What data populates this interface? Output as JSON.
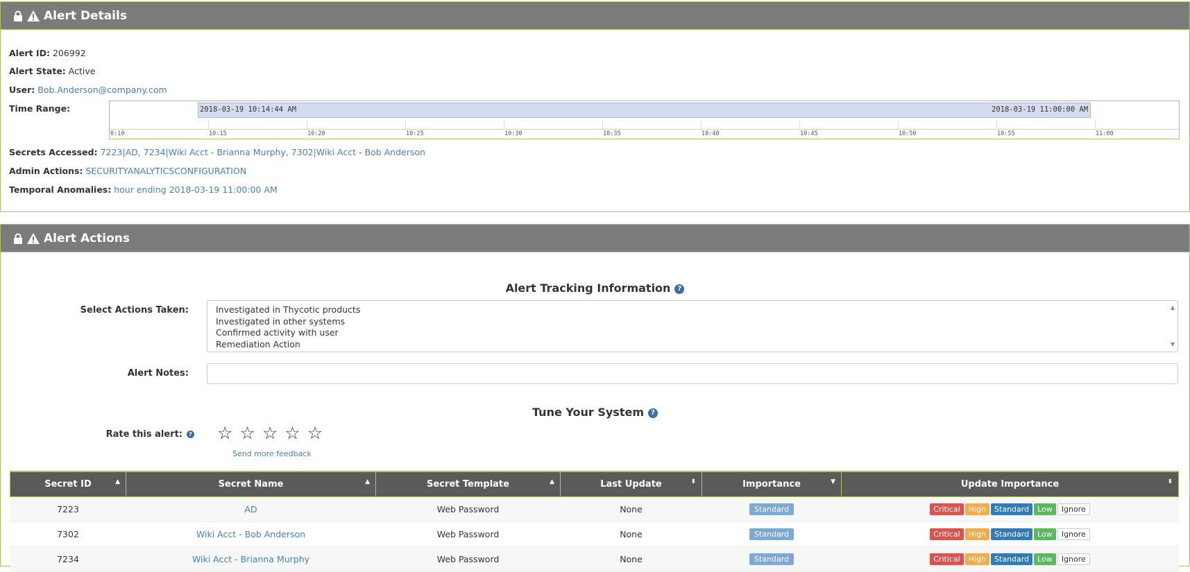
{
  "alert_details": {
    "title": "Alert Details",
    "alert_id_label": "Alert ID:",
    "alert_id": "206992",
    "alert_state_label": "Alert State:",
    "alert_state": "Active",
    "user_label": "User:",
    "user": "Bob.Anderson@company.com",
    "time_range_label": "Time Range:",
    "time_range": {
      "start": "2018-03-19 10:14:44 AM",
      "end": "2018-03-19 11:00:00 AM",
      "ticks": [
        "0:10",
        "10:15",
        "10:20",
        "10:25",
        "10:30",
        "10:35",
        "10:40",
        "10:45",
        "10:50",
        "10:55",
        "11:00"
      ]
    },
    "secrets_label": "Secrets Accessed:",
    "secrets": "7223|AD, 7234|Wiki Acct - Brianna Murphy, 7302|Wiki Acct - Bob Anderson",
    "admin_label": "Admin Actions:",
    "admin": "SECURITYANALYTICSCONFIGURATION",
    "temporal_label": "Temporal Anomalies:",
    "temporal": "hour ending 2018-03-19 11:00:00 AM"
  },
  "alert_actions": {
    "title": "Alert Actions",
    "tracking_title": "Alert Tracking Information",
    "select_label": "Select Actions Taken:",
    "actions_options": [
      "Investigated in Thycotic products",
      "Investigated in other systems",
      "Confirmed activity with user",
      "Remediation Action"
    ],
    "notes_label": "Alert Notes:",
    "notes_value": "",
    "tune_title": "Tune Your System",
    "rate_label": "Rate this alert:",
    "rating": 0,
    "feedback_link": "Send more feedback"
  },
  "table": {
    "headers": {
      "secret_id": "Secret ID",
      "secret_name": "Secret Name",
      "secret_template": "Secret Template",
      "last_update": "Last Update",
      "importance": "Importance",
      "update_importance": "Update Importance"
    },
    "buttons": {
      "critical": "Critical",
      "high": "High",
      "standard": "Standard",
      "low": "Low",
      "ignore": "Ignore"
    },
    "rows": [
      {
        "id": "7223",
        "name": "AD",
        "template": "Web Password",
        "last_update": "None",
        "importance": "Standard"
      },
      {
        "id": "7302",
        "name": "Wiki Acct - Bob Anderson",
        "template": "Web Password",
        "last_update": "None",
        "importance": "Standard"
      },
      {
        "id": "7234",
        "name": "Wiki Acct - Brianna Murphy",
        "template": "Web Password",
        "last_update": "None",
        "importance": "Standard"
      }
    ]
  },
  "colors": {
    "header_bg": "#7b7b7b",
    "border_green": "#a9c46a",
    "link": "#4a7fb5",
    "critical": "#d9534f",
    "high": "#f0ad4e",
    "standard": "#337ab7",
    "low": "#5cb85c"
  },
  "icons": [
    "lock-icon",
    "warning-icon",
    "help-icon",
    "star-icon",
    "sort-icon"
  ]
}
